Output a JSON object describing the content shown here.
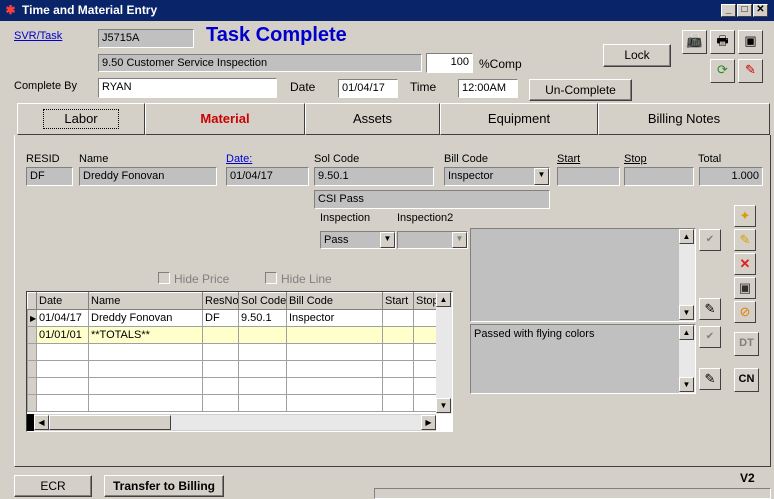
{
  "window": {
    "title": "Time and Material Entry"
  },
  "header": {
    "svr_link": "SVR/Task",
    "task_id": "J5715A",
    "status_title": "Task Complete",
    "task_desc": "9.50 Customer Service Inspection",
    "pct_value": "100",
    "pct_label": "%Comp",
    "lock_label": "Lock",
    "complete_by_label": "Complete By",
    "complete_by_value": "RYAN",
    "date_label": "Date",
    "date_value": "01/04/17",
    "time_label": "Time",
    "time_value": "12:00AM",
    "uncomplete_label": "Un-Complete"
  },
  "tabs": [
    "Labor",
    "Material",
    "Assets",
    "Equipment",
    "Billing Notes"
  ],
  "labor": {
    "resid_label": "RESID",
    "resid_value": "DF",
    "name_label": "Name",
    "name_value": "Dreddy Fonovan",
    "date_label": "Date:",
    "date_value": "01/04/17",
    "solcode_label": "Sol Code",
    "solcode_value": "9.50.1",
    "solcode_desc": "CSI Pass",
    "billcode_label": "Bill Code",
    "billcode_value": "Inspector",
    "start_label": "Start",
    "stop_label": "Stop",
    "total_label": "Total",
    "total_value": "1.000",
    "inspection_label": "Inspection",
    "inspection_value": "Pass",
    "inspection2_label": "Inspection2",
    "inspection2_value": "",
    "hide_price_label": "Hide Price",
    "hide_line_label": "Hide Line",
    "memo1": "",
    "memo2": "Passed with flying colors"
  },
  "grid": {
    "columns": [
      "Date",
      "Name",
      "ResNo",
      "Sol Code",
      "Bill Code",
      "Start",
      "Stop"
    ],
    "rows": [
      [
        "01/04/17",
        "Dreddy Fonovan",
        "DF",
        "9.50.1",
        "Inspector",
        "",
        ""
      ],
      [
        "01/01/01",
        "**TOTALS**",
        "",
        "",
        "",
        "",
        ""
      ],
      [
        "",
        "",
        "",
        "",
        "",
        "",
        ""
      ],
      [
        "",
        "",
        "",
        "",
        "",
        "",
        ""
      ],
      [
        "",
        "",
        "",
        "",
        "",
        "",
        ""
      ],
      [
        "",
        "",
        "",
        "",
        "",
        "",
        ""
      ]
    ]
  },
  "side_buttons": {
    "dt": "DT",
    "cn": "CN"
  },
  "footer": {
    "ecr": "ECR",
    "transfer": "Transfer to Billing",
    "version": "V2"
  },
  "colors": {
    "title_blue": "#0000cc",
    "material_red": "#cc0000",
    "totals_row": "#ffffcc"
  }
}
